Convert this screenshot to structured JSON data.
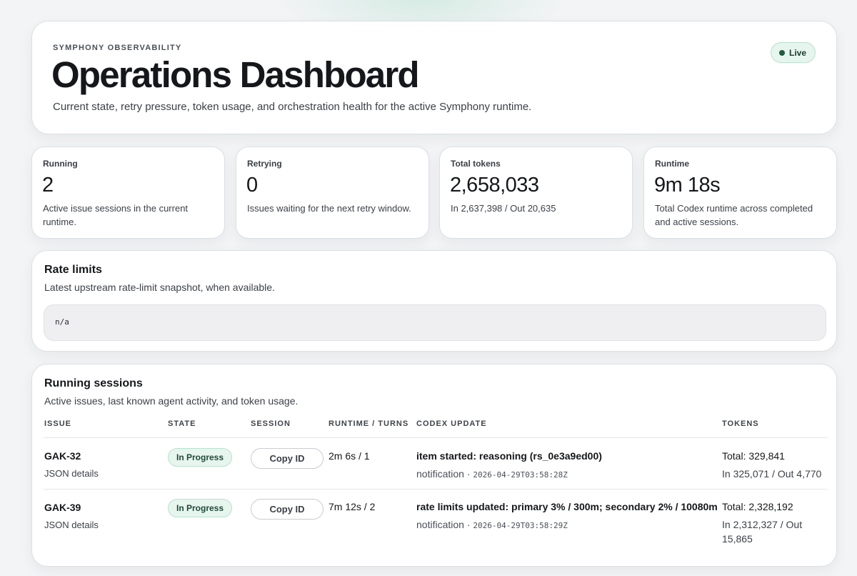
{
  "header": {
    "eyebrow": "SYMPHONY OBSERVABILITY",
    "title": "Operations Dashboard",
    "subtitle": "Current state, retry pressure, token usage, and orchestration health for the active Symphony runtime.",
    "status_badge": "Live"
  },
  "metrics": [
    {
      "label": "Running",
      "value": "2",
      "detail": "Active issue sessions in the current runtime."
    },
    {
      "label": "Retrying",
      "value": "0",
      "detail": "Issues waiting for the next retry window."
    },
    {
      "label": "Total tokens",
      "value": "2,658,033",
      "detail": "In 2,637,398 / Out 20,635"
    },
    {
      "label": "Runtime",
      "value": "9m 18s",
      "detail": "Total Codex runtime across completed and active sessions."
    }
  ],
  "rate_limits": {
    "title": "Rate limits",
    "subtitle": "Latest upstream rate-limit snapshot, when available.",
    "value": "n/a"
  },
  "sessions": {
    "title": "Running sessions",
    "subtitle": "Active issues, last known agent activity, and token usage.",
    "columns": [
      "ISSUE",
      "STATE",
      "SESSION",
      "RUNTIME / TURNS",
      "CODEX UPDATE",
      "TOKENS"
    ],
    "rows": [
      {
        "issue": "GAK-32",
        "details_link": "JSON details",
        "state": "In Progress",
        "session_button": "Copy ID",
        "runtime": "2m 6s / 1",
        "update_message": "item started: reasoning (rs_0e3a9ed00)",
        "update_kind": "notification",
        "update_time": "2026-04-29T03:58:28Z",
        "tokens_total": "Total: 329,841",
        "tokens_io": "In 325,071 / Out 4,770"
      },
      {
        "issue": "GAK-39",
        "details_link": "JSON details",
        "state": "In Progress",
        "session_button": "Copy ID",
        "runtime": "7m 12s / 2",
        "update_message": "rate limits updated: primary 3% / 300m; secondary 2% / 10080m",
        "update_kind": "notification",
        "update_time": "2026-04-29T03:58:29Z",
        "tokens_total": "Total: 2,328,192",
        "tokens_io": "In 2,312,327 / Out 15,865"
      }
    ]
  },
  "colors": {
    "accent_green": "#1f5c40",
    "badge_bg": "#e6f5ee",
    "page_bg": "#f3f4f6"
  }
}
